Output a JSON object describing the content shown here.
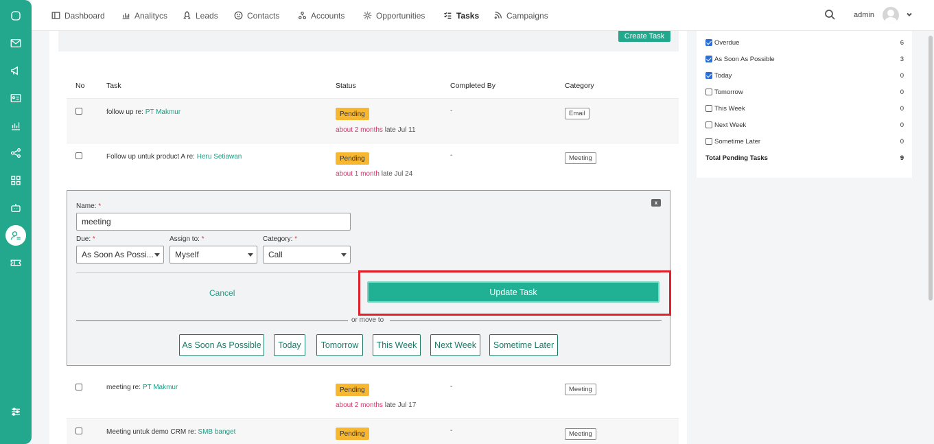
{
  "nav": {
    "items": [
      {
        "label": "Dashboard",
        "icon": "dashboard-icon"
      },
      {
        "label": "Analitycs",
        "icon": "analytics-icon"
      },
      {
        "label": "Leads",
        "icon": "rocket-icon"
      },
      {
        "label": "Contacts",
        "icon": "smile-icon"
      },
      {
        "label": "Accounts",
        "icon": "accounts-icon"
      },
      {
        "label": "Opportunities",
        "icon": "sun-icon"
      },
      {
        "label": "Tasks",
        "icon": "tasks-icon"
      },
      {
        "label": "Campaigns",
        "icon": "rss-icon"
      }
    ],
    "active": "Tasks",
    "user": "admin"
  },
  "main": {
    "create_button": "Create Task",
    "columns": {
      "no": "No",
      "task": "Task",
      "status": "Status",
      "completed_by": "Completed By",
      "category": "Category"
    },
    "rows": [
      {
        "text": "follow up re:",
        "link": "PT Makmur",
        "status": "Pending",
        "rel": "about 2 months",
        "late": "late Jul 11",
        "completed": "-",
        "category": "Email"
      },
      {
        "text": "Follow up untuk product A re:",
        "link": "Heru Setiawan",
        "status": "Pending",
        "rel": "about 1 month",
        "late": "late Jul 24",
        "completed": "-",
        "category": "Meeting"
      },
      {
        "text": "meeting re:",
        "link": "PT Makmur",
        "status": "Pending",
        "rel": "about 2 months",
        "late": "late Jul 17",
        "completed": "-",
        "category": "Meeting"
      },
      {
        "text": "Meeting untuk demo CRM re:",
        "link": "SMB banget",
        "status": "Pending",
        "rel": "",
        "late": "",
        "completed": "-",
        "category": "Meeting"
      }
    ]
  },
  "edit_form": {
    "close": "x",
    "name_label": "Name:",
    "name_value": "meeting",
    "due_label": "Due:",
    "due_value": "As Soon As Possi...",
    "assign_label": "Assign to:",
    "assign_value": "Myself",
    "category_label": "Category:",
    "category_value": "Call",
    "required": "*",
    "cancel": "Cancel",
    "update": "Update Task",
    "move_to": "or move to",
    "move_buttons": [
      "As Soon As Possible",
      "Today",
      "Tomorrow",
      "This Week",
      "Next Week",
      "Sometime Later"
    ]
  },
  "filters": {
    "items": [
      {
        "label": "Overdue",
        "count": "6",
        "checked": true
      },
      {
        "label": "As Soon As Possible",
        "count": "3",
        "checked": true
      },
      {
        "label": "Today",
        "count": "0",
        "checked": true
      },
      {
        "label": "Tomorrow",
        "count": "0",
        "checked": false
      },
      {
        "label": "This Week",
        "count": "0",
        "checked": false
      },
      {
        "label": "Next Week",
        "count": "0",
        "checked": false
      },
      {
        "label": "Sometime Later",
        "count": "0",
        "checked": false
      }
    ],
    "total_label": "Total Pending Tasks",
    "total_count": "9"
  },
  "colors": {
    "brand": "#23a88e",
    "pending": "#f7b731",
    "late": "#d6336c",
    "highlight": "#e0202a"
  }
}
